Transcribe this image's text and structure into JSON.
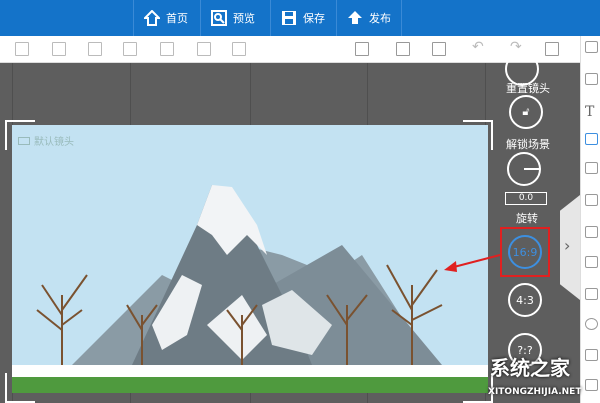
{
  "topbar": {
    "buttons": [
      {
        "label": "首页",
        "icon": "home-icon"
      },
      {
        "label": "预览",
        "icon": "preview-icon"
      },
      {
        "label": "保存",
        "icon": "save-icon"
      },
      {
        "label": "发布",
        "icon": "publish-icon"
      }
    ]
  },
  "canvas": {
    "camera_label": "默认镜头"
  },
  "controls": {
    "reset_label": "重置镜头",
    "unlock_label": "解锁场景",
    "rotation_value": "0.0",
    "rotate_label": "旋转",
    "ratio_169": "16:9",
    "ratio_43": "4:3",
    "ratio_custom": "?:?"
  },
  "colors": {
    "topbar": "#1473c9",
    "highlight": "#e02020",
    "selected": "#3d8fe0"
  },
  "watermark": {
    "text": "系统之家",
    "url": "XITONGZHIJIA.NET"
  }
}
